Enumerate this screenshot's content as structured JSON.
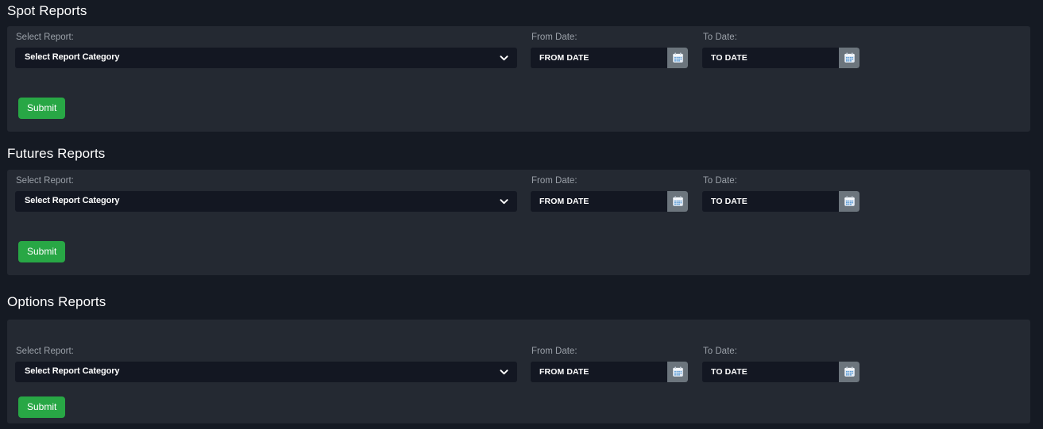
{
  "theme": {
    "page_background": "#151a23",
    "panel_background": "#242932",
    "input_background": "#131722",
    "accent_green": "#28a745",
    "label_color": "#9aa0a8",
    "text_color": "#ffffff",
    "calendar_button_background": "#6c757d"
  },
  "sections": [
    {
      "id": "spot",
      "title": "Spot Reports",
      "select_label": "Select Report:",
      "select_value": "Select Report Category",
      "select_options": [
        "Select Report Category"
      ],
      "from_label": "From Date:",
      "from_value": "",
      "from_placeholder": "FROM DATE",
      "to_label": "To Date:",
      "to_value": "",
      "to_placeholder": "TO DATE",
      "submit_label": "Submit",
      "calendar_icon": "calendar-icon",
      "chevron_icon": "chevron-down-icon"
    },
    {
      "id": "futures",
      "title": "Futures Reports",
      "select_label": "Select Report:",
      "select_value": "Select Report Category",
      "select_options": [
        "Select Report Category"
      ],
      "from_label": "From Date:",
      "from_value": "",
      "from_placeholder": "FROM DATE",
      "to_label": "To Date:",
      "to_value": "",
      "to_placeholder": "TO DATE",
      "submit_label": "Submit",
      "calendar_icon": "calendar-icon",
      "chevron_icon": "chevron-down-icon"
    },
    {
      "id": "options",
      "title": "Options Reports",
      "select_label": "Select Report:",
      "select_value": "Select Report Category",
      "select_options": [
        "Select Report Category"
      ],
      "from_label": "From Date:",
      "from_value": "",
      "from_placeholder": "FROM DATE",
      "to_label": "To Date:",
      "to_value": "",
      "to_placeholder": "TO DATE",
      "submit_label": "Submit",
      "calendar_icon": "calendar-icon",
      "chevron_icon": "chevron-down-icon"
    }
  ]
}
